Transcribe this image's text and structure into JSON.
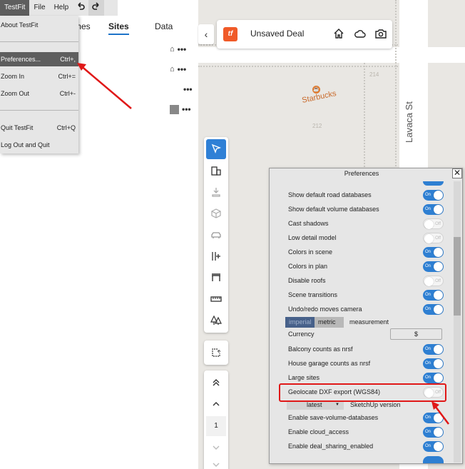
{
  "menubar": {
    "items": [
      "TestFit",
      "File",
      "Help"
    ],
    "undo_icon": "undo-icon",
    "redo_icon": "redo-icon"
  },
  "file_menu": {
    "items": [
      {
        "label": "About TestFit",
        "shortcut": ""
      },
      {
        "label": "Preferences...",
        "shortcut": "Ctrl+,"
      },
      {
        "label": "Zoom In",
        "shortcut": "Ctrl+="
      },
      {
        "label": "Zoom Out",
        "shortcut": "Ctrl+-"
      },
      {
        "label": "Quit TestFit",
        "shortcut": "Ctrl+Q"
      },
      {
        "label": "Log Out and Quit",
        "shortcut": ""
      }
    ]
  },
  "tabs": {
    "partial": "mes",
    "sites": "Sites",
    "data": "Data"
  },
  "header": {
    "title": "Unsaved Deal",
    "logo_text": "tf",
    "icons": [
      "home-icon",
      "cloud-icon",
      "camera-icon"
    ]
  },
  "map": {
    "street": "Lavaca St",
    "poi": "Starbucks",
    "parcel_numbers": [
      "214",
      "212"
    ]
  },
  "pagination": {
    "page": "1"
  },
  "preferences": {
    "title": "Preferences",
    "rows": [
      {
        "label": "Show default road databases",
        "state": "On"
      },
      {
        "label": "Show default volume databases",
        "state": "On"
      },
      {
        "label": "Cast shadows",
        "state": "Off"
      },
      {
        "label": "Low detail model",
        "state": "Off"
      },
      {
        "label": "Colors in scene",
        "state": "On"
      },
      {
        "label": "Colors in plan",
        "state": "On"
      },
      {
        "label": "Disable roofs",
        "state": "Off"
      },
      {
        "label": "Scene transitions",
        "state": "On"
      },
      {
        "label": "Undo/redo moves camera",
        "state": "On"
      }
    ],
    "units": {
      "imperial": "imperial",
      "metric": "metric",
      "label": "measurement",
      "selected": "imperial"
    },
    "currency": {
      "label": "Currency",
      "value": "$"
    },
    "rows2": [
      {
        "label": "Balcony counts as nrsf",
        "state": "On"
      },
      {
        "label": "House garage counts as nrsf",
        "state": "On"
      },
      {
        "label": "Large sites",
        "state": "On"
      },
      {
        "label": "Geolocate DXF export (WGS84)",
        "state": "Off"
      }
    ],
    "sketchup": {
      "value": "latest",
      "label": "SketchUp version"
    },
    "rows3": [
      {
        "label": "Enable save-volume-databases",
        "state": "On"
      },
      {
        "label": "Enable cloud_access",
        "state": "On"
      },
      {
        "label": "Enable deal_sharing_enabled",
        "state": "On"
      }
    ]
  },
  "colors": {
    "accent": "#2e7fd2",
    "brand": "#f05a28",
    "annotation": "#e01818"
  }
}
